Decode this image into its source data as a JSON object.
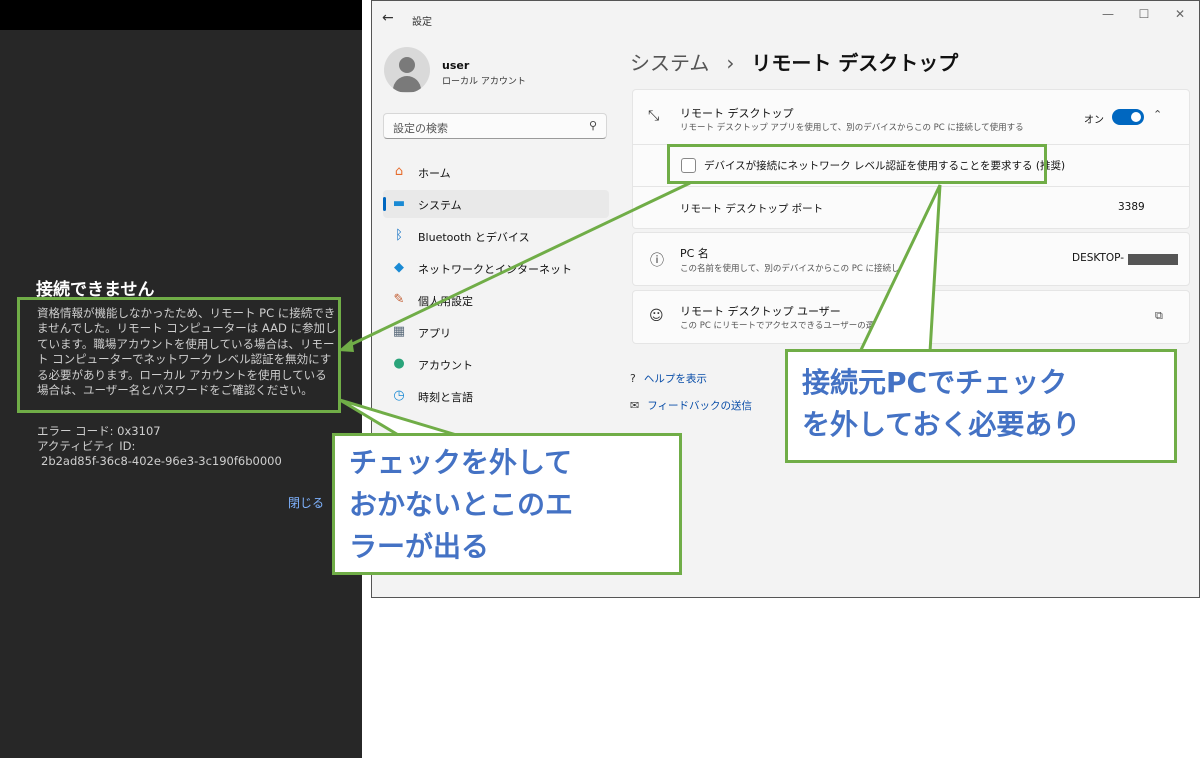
{
  "phone": {
    "title": "接続できません",
    "body": "資格情報が機能しなかったため、リモート PC に接続できませんでした。リモート コンピューターは AAD に参加しています。職場アカウントを使用している場合は、リモート コンピューターでネットワーク レベル認証を無効にする必要があります。ローカル アカウントを使用している場合は、ユーザー名とパスワードをご確認ください。",
    "error_code": "エラー コード: 0x3107",
    "activity_label": "アクティビティ ID:",
    "activity_id": "2b2ad85f-36c8-402e-96e3-3c190f6b0000",
    "close_label": "閉じる"
  },
  "settings": {
    "window_title": "設定",
    "user": {
      "name": "user",
      "account_type": "ローカル アカウント"
    },
    "search_placeholder": "設定の検索",
    "nav": [
      {
        "label": "ホーム",
        "icon": "home-icon",
        "glyph": "⌂",
        "color": "#e66c2c"
      },
      {
        "label": "システム",
        "icon": "system-icon",
        "glyph": "▬",
        "color": "#1a8ad4",
        "active": true
      },
      {
        "label": "Bluetooth とデバイス",
        "icon": "bluetooth-icon",
        "glyph": "ᛒ",
        "color": "#0067c0"
      },
      {
        "label": "ネットワークとインターネット",
        "icon": "wifi-icon",
        "glyph": "◆",
        "color": "#1a8ad4"
      },
      {
        "label": "個人用設定",
        "icon": "brush-icon",
        "glyph": "✎",
        "color": "#c25b2f"
      },
      {
        "label": "アプリ",
        "icon": "apps-icon",
        "glyph": "▦",
        "color": "#5a6b7b"
      },
      {
        "label": "アカウント",
        "icon": "account-icon",
        "glyph": "●",
        "color": "#2aa47a"
      },
      {
        "label": "時刻と言語",
        "icon": "clock-globe-icon",
        "glyph": "◷",
        "color": "#1a8ad4"
      }
    ],
    "breadcrumb_parent": "システム",
    "breadcrumb_sep": "›",
    "page_title": "リモート デスクトップ",
    "rd_card": {
      "title": "リモート デスクトップ",
      "subtitle": "リモート デスクトップ アプリを使用して、別のデバイスからこの PC に接続して使用する",
      "toggle_label": "オン",
      "toggle_on": true
    },
    "nla_checkbox": {
      "label": "デバイスが接続にネットワーク レベル認証を使用することを要求する (推奨)",
      "checked": false
    },
    "port": {
      "label": "リモート デスクトップ ポート",
      "value": "3389"
    },
    "pc_name": {
      "title": "PC 名",
      "subtitle": "この名前を使用して、別のデバイスからこの PC に接続しま",
      "value": "DESKTOP-"
    },
    "rd_users": {
      "title": "リモート デスクトップ ユーザー",
      "subtitle": "この PC にリモートでアクセスできるユーザーの選択"
    },
    "links": {
      "help": "ヘルプを表示",
      "feedback": "フィードバックの送信"
    }
  },
  "annotations": {
    "callout_settings": [
      "接続元PCでチェック",
      "を外しておく必要あり"
    ],
    "callout_error": [
      "チェックを外して",
      "おかないとこのエ",
      "ラーが出る"
    ],
    "accent_color": "#70ad47",
    "text_color": "#4472c4"
  }
}
